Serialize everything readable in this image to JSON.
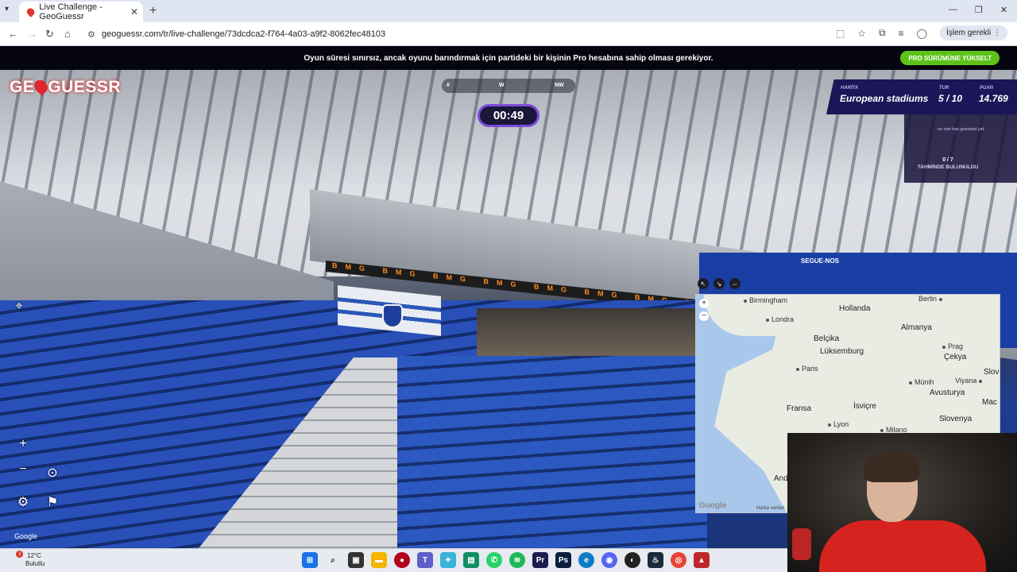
{
  "browser": {
    "tab_title": "Live Challenge - GeoGuessr",
    "tab_close": "✕",
    "new_tab": "+",
    "url": "geoguessr.com/tr/live-challenge/73dcdca2-f764-4a03-a9f2-8062fec48103",
    "action_required": "İşlem gerekli",
    "window_controls": [
      "—",
      "❐",
      "✕"
    ]
  },
  "promo": {
    "message": "Oyun süresi sınırsız, ancak oyunu barındırmak için partideki bir kişinin Pro hesabına sahip olması gerekiyor.",
    "upgrade_button": "PRO SÜRÜMÜNE YÜKSELT"
  },
  "game": {
    "logo_left": "GE",
    "logo_right": "GUESSR",
    "compass": {
      "left": "#",
      "center": "W",
      "right": "NW"
    },
    "timer": "00:49",
    "status": {
      "map_label": "HARİTA",
      "map_value": "European stadiums",
      "round_label": "TUR",
      "round_value": "5 / 10",
      "score_label": "PUAN",
      "score_value": "14.769"
    },
    "guess_panel": {
      "no_guess_text": "no one has guessed yet",
      "count": "0 / 7",
      "label": "TAHMİNDE BULUNULDU"
    },
    "ad_board_text": "BMG BMG BMG BMG BMG BMG BMG BMG BMG BMG BMG",
    "right_board_text": "SEGUE-NOS",
    "pano_attribution": "Google"
  },
  "map": {
    "cities": [
      "Birmingham",
      "Londra",
      "Paris",
      "Berlin",
      "Prag",
      "Münih",
      "Viyana",
      "Lyon",
      "Milano"
    ],
    "countries": [
      "Hollanda",
      "Almanya",
      "Belçika",
      "Lüksemburg",
      "Çekya",
      "Fransa",
      "İsviçre",
      "Avusturya",
      "Slovenya",
      "Slov",
      "Mac",
      "And"
    ],
    "attribution": "Google",
    "data_credit": "Harita verileri"
  },
  "taskbar": {
    "temperature": "12°C",
    "condition": "Bulutlu",
    "badge_count": "3"
  }
}
